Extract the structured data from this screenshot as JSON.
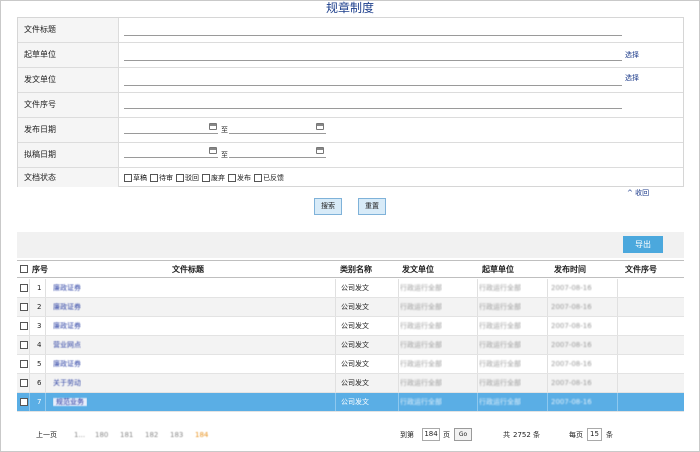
{
  "page": {
    "title": "规章制度"
  },
  "form": {
    "fields": {
      "doc_title": {
        "label": "文件标题"
      },
      "draft_unit": {
        "label": "起草单位",
        "pick": "选择"
      },
      "issue_unit": {
        "label": "发文单位",
        "pick": "选择"
      },
      "doc_serial": {
        "label": "文件序号"
      },
      "publish_date": {
        "label": "发布日期",
        "to": "至"
      },
      "draft_date": {
        "label": "拟稿日期",
        "to": "至"
      },
      "doc_status": {
        "label": "文档状态"
      }
    },
    "status_options": [
      "草稿",
      "待审",
      "驳回",
      "废弃",
      "发布",
      "已反馈"
    ],
    "collapse": "^ 收回",
    "search_button": "搜索",
    "reset_button": "重置"
  },
  "toolbar": {
    "export": "导出"
  },
  "table": {
    "headers": {
      "no": "序号",
      "title": "文件标题",
      "category": "类别名称",
      "issue_unit": "发文单位",
      "draft_unit": "起草单位",
      "publish_time": "发布时间",
      "serial": "文件序号"
    },
    "rows": [
      {
        "no": "1",
        "title": "廉政证券",
        "category": "公司发文",
        "issue_unit": "行政运行全部",
        "draft_unit": "行政运行全部",
        "publish_time": "2007-08-16",
        "serial": ""
      },
      {
        "no": "2",
        "title": "廉政证券",
        "category": "公司发文",
        "issue_unit": "行政运行全部",
        "draft_unit": "行政运行全部",
        "publish_time": "2007-08-16",
        "serial": ""
      },
      {
        "no": "3",
        "title": "廉政证券",
        "category": "公司发文",
        "issue_unit": "行政运行全部",
        "draft_unit": "行政运行全部",
        "publish_time": "2007-08-16",
        "serial": ""
      },
      {
        "no": "4",
        "title": "营业网点",
        "category": "公司发文",
        "issue_unit": "行政运行全部",
        "draft_unit": "行政运行全部",
        "publish_time": "2007-08-16",
        "serial": ""
      },
      {
        "no": "5",
        "title": "廉政证券",
        "category": "公司发文",
        "issue_unit": "行政运行全部",
        "draft_unit": "行政运行全部",
        "publish_time": "2007-08-16",
        "serial": ""
      },
      {
        "no": "6",
        "title": "关于劳动",
        "category": "公司发文",
        "issue_unit": "行政运行全部",
        "draft_unit": "行政运行全部",
        "publish_time": "2007-08-16",
        "serial": ""
      },
      {
        "no": "7",
        "title": "规范业务",
        "category": "公司发文",
        "issue_unit": "行政运行全部",
        "draft_unit": "行政运行全部",
        "publish_time": "2007-08-16",
        "serial": "",
        "selected": true
      }
    ]
  },
  "pager": {
    "prev": "上一页",
    "pages": [
      "1...",
      "180",
      "181",
      "182",
      "183",
      "184"
    ],
    "current": "184",
    "goto_prefix": "到第",
    "goto_value": "184",
    "goto_suffix": "页",
    "go": "Go",
    "total_prefix": "共",
    "total": "2752",
    "total_suffix": "条",
    "per_page_prefix": "每页",
    "per_page": "15",
    "per_page_suffix": "条"
  },
  "colors": {
    "accent": "#4ba8dd",
    "selected_row": "#5aaee5",
    "title": "#1d3f8c",
    "current_page": "#e8911d"
  }
}
